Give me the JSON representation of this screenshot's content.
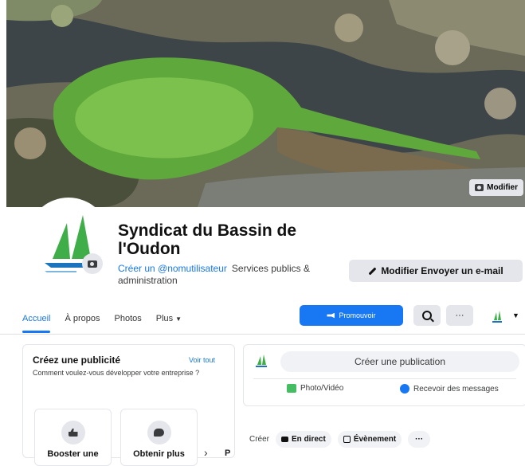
{
  "cover": {
    "edit_label": "Modifier"
  },
  "page": {
    "title": "Syndicat du Bassin de l'Oudon",
    "username_cta": "Créer un @nomutilisateur",
    "category": "Services publics & administration"
  },
  "header_actions": {
    "label": "Modifier Envoyer un e-mail"
  },
  "nav": {
    "tabs": [
      {
        "label": "Accueil"
      },
      {
        "label": "À propos"
      },
      {
        "label": "Photos"
      },
      {
        "label": "Plus"
      }
    ],
    "promote_label": "Promouvoir"
  },
  "ad_card": {
    "title": "Créez une publicité",
    "see_all": "Voir tout",
    "description": "Comment voulez-vous développer votre entreprise ?",
    "options": [
      {
        "label": "Booster une"
      },
      {
        "label": "Obtenir plus"
      }
    ],
    "truncated": "P"
  },
  "composer": {
    "placeholder": "Créer une publication",
    "photo_video": "Photo/Vidéo",
    "messages": "Recevoir des messages"
  },
  "create_row": {
    "label": "Créer",
    "live": "En direct",
    "event": "Évènement",
    "more": "···"
  },
  "colors": {
    "accent": "#1877f2",
    "logo_green": "#3fae49"
  }
}
